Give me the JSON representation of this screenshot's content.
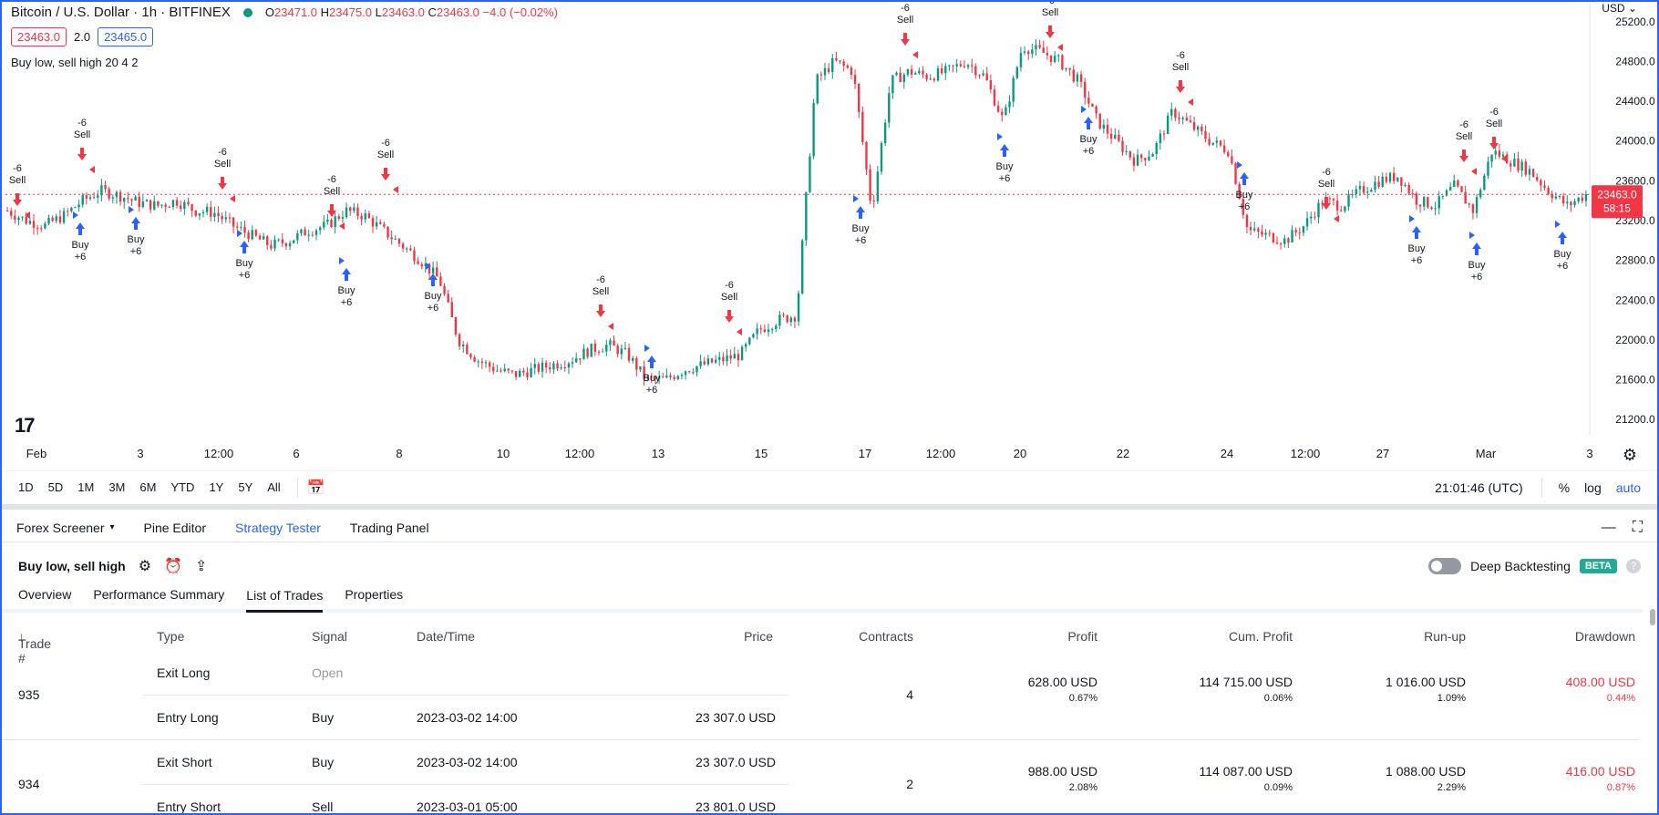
{
  "legend": {
    "symbol": "Bitcoin / U.S. Dollar · 1h · BITFINEX",
    "o_label": "O",
    "o": "23471.0",
    "h_label": "H",
    "h": "23475.0",
    "l_label": "L",
    "l": "23463.0",
    "c_label": "C",
    "c": "23463.0",
    "change": "−4.0 (−0.02%)",
    "bid": "23463.0",
    "spread": "2.0",
    "ask": "23465.0",
    "indicator": "Buy low, sell high 20 4 2"
  },
  "currency": "USD",
  "price_axis": [
    "25200.0",
    "24800.0",
    "24400.0",
    "24000.0",
    "23600.0",
    "23200.0",
    "22800.0",
    "22400.0",
    "22000.0",
    "21600.0",
    "21200.0"
  ],
  "last_price": {
    "value": "23463.0",
    "countdown": "58:15"
  },
  "time_axis": [
    "Feb",
    "3",
    "12:00",
    "6",
    "8",
    "10",
    "12:00",
    "13",
    "15",
    "17",
    "12:00",
    "20",
    "22",
    "24",
    "12:00",
    "27",
    "Mar",
    "3"
  ],
  "signals": {
    "sell_qty": "-6",
    "sell_label": "Sell",
    "buy_label": "Buy",
    "buy_qty": "+6"
  },
  "chart_data": {
    "type": "candlestick",
    "symbol": "BTCUSD",
    "ylim": [
      21000,
      25400
    ],
    "series_close_approx": [
      23300,
      23200,
      23150,
      23250,
      23400,
      23500,
      23450,
      23380,
      23350,
      23400,
      23300,
      23280,
      23150,
      23050,
      22950,
      23000,
      23100,
      23150,
      23300,
      23250,
      23100,
      22950,
      22800,
      22600,
      22000,
      21800,
      21700,
      21650,
      21700,
      21750,
      21800,
      21900,
      21950,
      21850,
      21600,
      21600,
      21700,
      21750,
      21800,
      21850,
      22100,
      22200,
      22250,
      24600,
      24800,
      24700,
      23300,
      24600,
      24700,
      24650,
      24700,
      24800,
      24650,
      24200,
      24950,
      24900,
      24800,
      24600,
      24200,
      24000,
      23800,
      23900,
      24300,
      24150,
      24000,
      23900,
      23100,
      23050,
      23000,
      23150,
      23400,
      23350,
      23500,
      23600,
      23650,
      23400,
      23350,
      23550,
      23300,
      23900,
      23800,
      23700,
      23500,
      23350,
      23463
    ]
  },
  "range_buttons": [
    "1D",
    "5D",
    "1M",
    "3M",
    "6M",
    "YTD",
    "1Y",
    "5Y",
    "All"
  ],
  "clock": "21:01:46 (UTC)",
  "scale_buttons": {
    "percent": "%",
    "log": "log",
    "auto": "auto"
  },
  "panel_tabs": {
    "screener": "Forex Screener",
    "pine": "Pine Editor",
    "tester": "Strategy Tester",
    "trading": "Trading Panel"
  },
  "strategy": {
    "name": "Buy low, sell high",
    "deep_label": "Deep Backtesting",
    "beta": "BETA"
  },
  "sub_tabs": [
    "Overview",
    "Performance Summary",
    "List of Trades",
    "Properties"
  ],
  "columns": {
    "trade": "Trade #",
    "type": "Type",
    "signal": "Signal",
    "datetime": "Date/Time",
    "price": "Price",
    "contracts": "Contracts",
    "profit": "Profit",
    "cum": "Cum. Profit",
    "runup": "Run-up",
    "drawdown": "Drawdown"
  },
  "trades": [
    {
      "num": "935",
      "exit": {
        "type": "Exit Long",
        "signal": "Open",
        "datetime": "",
        "price": ""
      },
      "entry": {
        "type": "Entry Long",
        "signal": "Buy",
        "datetime": "2023-03-02 14:00",
        "price": "23 307.0 USD"
      },
      "contracts": "4",
      "profit": "628.00 USD",
      "profit_pct": "0.67%",
      "cum": "114 715.00 USD",
      "cum_pct": "0.06%",
      "runup": "1 016.00 USD",
      "runup_pct": "1.09%",
      "dd": "408.00 USD",
      "dd_pct": "0.44%"
    },
    {
      "num": "934",
      "exit": {
        "type": "Exit Short",
        "signal": "Buy",
        "datetime": "2023-03-02 14:00",
        "price": "23 307.0 USD"
      },
      "entry": {
        "type": "Entry Short",
        "signal": "Sell",
        "datetime": "2023-03-01 05:00",
        "price": "23 801.0 USD"
      },
      "contracts": "2",
      "profit": "988.00 USD",
      "profit_pct": "2.08%",
      "cum": "114 087.00 USD",
      "cum_pct": "0.09%",
      "runup": "1 088.00 USD",
      "runup_pct": "2.29%",
      "dd": "416.00 USD",
      "dd_pct": "0.87%"
    }
  ],
  "colors": {
    "up": "#089981",
    "down": "#f23645",
    "accent": "#2962ff",
    "buy": "#2962ff",
    "sell": "#f23645"
  }
}
